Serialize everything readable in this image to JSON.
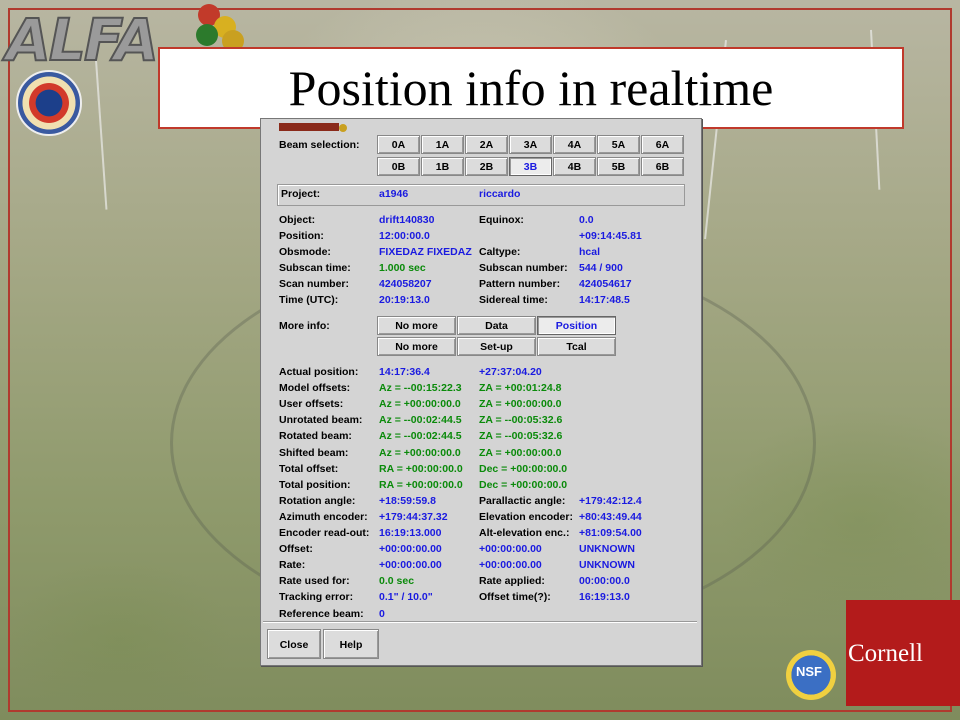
{
  "slide": {
    "title": "Position info in realtime",
    "logo_text": "ALFA",
    "sponsor_nsf": "NSF",
    "sponsor_cornell": "Cornell"
  },
  "window": {
    "beam_selection": {
      "label": "Beam selection:",
      "row1": [
        "0A",
        "1A",
        "2A",
        "3A",
        "4A",
        "5A",
        "6A"
      ],
      "row2": [
        "0B",
        "1B",
        "2B",
        "3B",
        "4B",
        "5B",
        "6B"
      ],
      "selected": "3B"
    },
    "project": {
      "label": "Project:",
      "id": "a1946",
      "user": "riccardo"
    },
    "rows_left": [
      {
        "label": "Object:",
        "value": "drift140830",
        "color": "blue"
      },
      {
        "label": "Position:",
        "value": "12:00:00.0",
        "color": "blue"
      },
      {
        "label": "Obsmode:",
        "value": "FIXEDAZ FIXEDAZ",
        "color": "blue"
      },
      {
        "label": "Subscan time:",
        "value": "1.000  sec",
        "color": "green"
      },
      {
        "label": "Scan number:",
        "value": "424058207",
        "color": "blue"
      },
      {
        "label": "Time (UTC):",
        "value": "20:19:13.0",
        "color": "blue"
      }
    ],
    "rows_right": [
      {
        "label": "Equinox:",
        "value": "0.0",
        "color": "blue"
      },
      {
        "label": "",
        "value": "+09:14:45.81",
        "color": "blue"
      },
      {
        "label": "Caltype:",
        "value": "hcal",
        "color": "blue"
      },
      {
        "label": "Subscan number:",
        "value": "544  /  900",
        "color": "blue"
      },
      {
        "label": "Pattern number:",
        "value": "424054617",
        "color": "blue"
      },
      {
        "label": "Sidereal time:",
        "value": "14:17:48.5",
        "color": "blue"
      }
    ],
    "more_info": {
      "label": "More info:",
      "row1": [
        "No more",
        "Data",
        "Position"
      ],
      "row2": [
        "No more",
        "Set-up",
        "Tcal"
      ],
      "selected": "Position"
    },
    "position_rows": [
      {
        "label": "Actual position:",
        "v1": "14:17:36.4",
        "v2": "+27:37:04.20",
        "v3": "",
        "c1": "blue",
        "c2": "blue"
      },
      {
        "label": "Model offsets:",
        "v1": "Az =  --00:15:22.3",
        "v2": "ZA =  +00:01:24.8",
        "v3": "",
        "c1": "green",
        "c2": "green"
      },
      {
        "label": "User offsets:",
        "v1": "Az =  +00:00:00.0",
        "v2": "ZA =  +00:00:00.0",
        "v3": "",
        "c1": "green",
        "c2": "green"
      },
      {
        "label": "Unrotated beam:",
        "v1": "Az =  --00:02:44.5",
        "v2": "ZA =  --00:05:32.6",
        "v3": "",
        "c1": "green",
        "c2": "green"
      },
      {
        "label": "Rotated beam:",
        "v1": "Az =  --00:02:44.5",
        "v2": "ZA =  --00:05:32.6",
        "v3": "",
        "c1": "green",
        "c2": "green"
      },
      {
        "label": "Shifted beam:",
        "v1": "Az =  +00:00:00.0",
        "v2": "ZA =  +00:00:00.0",
        "v3": "",
        "c1": "green",
        "c2": "green"
      },
      {
        "label": "Total offset:",
        "v1": "RA =  +00:00:00.0",
        "v2": "Dec =  +00:00:00.0",
        "v3": "",
        "c1": "green",
        "c2": "green"
      },
      {
        "label": "Total position:",
        "v1": "RA =  +00:00:00.0",
        "v2": "Dec =  +00:00:00.0",
        "v3": "",
        "c1": "green",
        "c2": "green"
      },
      {
        "label": "Rotation angle:",
        "v1": "+18:59:59.8",
        "v2": "Parallactic angle:",
        "v3": "+179:42:12.4",
        "c1": "blue",
        "c2": "label"
      },
      {
        "label": "Azimuth encoder:",
        "v1": "+179:44:37.32",
        "v2": "Elevation encoder:",
        "v3": "+80:43:49.44",
        "c1": "blue",
        "c2": "label"
      },
      {
        "label": "Encoder read-out:",
        "v1": "16:19:13.000",
        "v2": "Alt-elevation enc.:",
        "v3": "+81:09:54.00",
        "c1": "blue",
        "c2": "label"
      },
      {
        "label": "Offset:",
        "v1": "+00:00:00.00",
        "v2": "+00:00:00.00",
        "v3": "UNKNOWN",
        "c1": "blue",
        "c2": "blue"
      },
      {
        "label": "Rate:",
        "v1": "+00:00:00.00",
        "v2": "+00:00:00.00",
        "v3": "UNKNOWN",
        "c1": "blue",
        "c2": "blue"
      },
      {
        "label": "Rate used for:",
        "v1": "0.0  sec",
        "v2": "Rate applied:",
        "v3": "00:00:00.0",
        "c1": "green",
        "c2": "label"
      },
      {
        "label": "Tracking error:",
        "v1": "0.1\"  /  10.0\"",
        "v2": "Offset time(?):",
        "v3": "16:19:13.0",
        "c1": "blue",
        "c2": "label"
      },
      {
        "label": "Reference beam:",
        "v1": "0",
        "v2": "",
        "v3": "",
        "c1": "blue",
        "c2": "blue"
      }
    ],
    "buttons": {
      "close": "Close",
      "help": "Help"
    }
  }
}
